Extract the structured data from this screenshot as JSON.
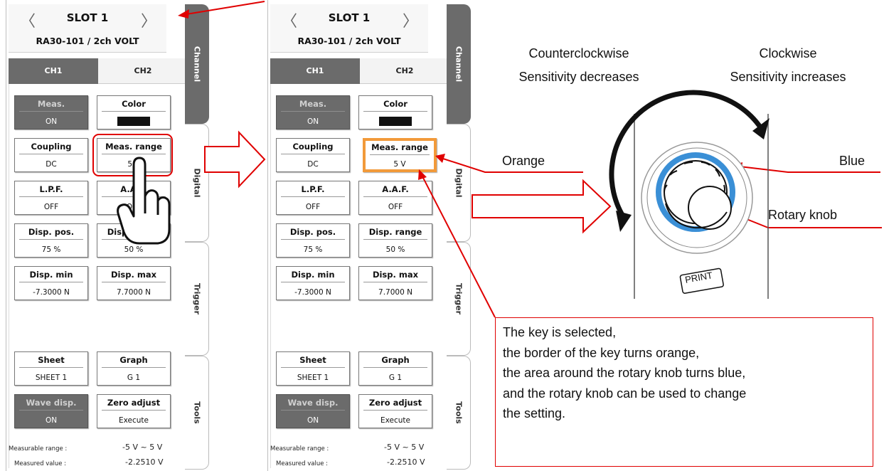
{
  "panel": {
    "nav_prev": "〈",
    "nav_next": "〉",
    "slot_title": "SLOT 1",
    "module": "RA30-101 / 2ch VOLT",
    "tabs": [
      "CH1",
      "CH2"
    ],
    "side_tabs": [
      "Channel",
      "Digital",
      "Trigger",
      "Tools"
    ],
    "keys": {
      "meas": {
        "title": "Meas.",
        "value": "ON"
      },
      "color": {
        "title": "Color"
      },
      "coupling": {
        "title": "Coupling",
        "value": "DC"
      },
      "meas_range": {
        "title": "Meas. range",
        "value": "5 V"
      },
      "lpf": {
        "title": "L.P.F.",
        "value": "OFF"
      },
      "aaf": {
        "title": "A.A.F.",
        "value": "OFF"
      },
      "disp_pos": {
        "title": "Disp. pos.",
        "value": "75 %"
      },
      "disp_range": {
        "title": "Disp. range",
        "value": "50 %"
      },
      "disp_min": {
        "title": "Disp. min",
        "value": "-7.3000 N"
      },
      "disp_max": {
        "title": "Disp. max",
        "value": "7.7000 N"
      },
      "sheet": {
        "title": "Sheet",
        "value": "SHEET 1"
      },
      "graph": {
        "title": "Graph",
        "value": "G 1"
      },
      "wave_disp": {
        "title": "Wave disp.",
        "value": "ON"
      },
      "zero_adjust": {
        "title": "Zero adjust",
        "value": "Execute"
      }
    },
    "footer": {
      "range_label": "Measurable range :",
      "range_value": "-5 V ~ 5 V",
      "measured_label": "Measured value :",
      "measured_value": "-2.2510 V"
    }
  },
  "callouts": {
    "ccw_line1": "Counterclockwise",
    "ccw_line2": "Sensitivity decreases",
    "cw_line1": "Clockwise",
    "cw_line2": "Sensitivity increases",
    "orange": "Orange",
    "blue": "Blue",
    "knob": "Rotary knob",
    "print": "PRINT",
    "note": [
      "The key is selected,",
      "the border of the key turns orange,",
      "the area around the rotary knob turns blue,",
      "and the rotary knob can be used to change",
      "the setting."
    ]
  },
  "colors": {
    "callout_red": "#e00000",
    "selected_orange": "#f29a3a",
    "knob_blue": "#3a8fd6",
    "selected_key": "#6b6b6b"
  }
}
